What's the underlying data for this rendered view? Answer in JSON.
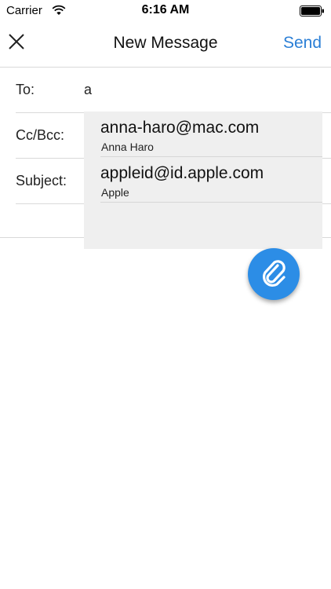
{
  "status_bar": {
    "carrier": "Carrier",
    "time": "6:16 AM",
    "wifi_icon": "wifi-icon",
    "battery_icon": "battery-full-icon"
  },
  "nav": {
    "title": "New Message",
    "close_icon": "close-icon",
    "send_label": "Send"
  },
  "fields": {
    "to_label": "To:",
    "to_value": "a",
    "cc_label": "Cc/Bcc:",
    "subject_label": "Subject:"
  },
  "suggestions": [
    {
      "email": "anna-haro@mac.com",
      "name": "Anna Haro"
    },
    {
      "email": "appleid@id.apple.com",
      "name": "Apple"
    }
  ],
  "fab": {
    "icon": "paperclip-icon"
  },
  "colors": {
    "accent": "#2b7fd6",
    "fab": "#2c8de6",
    "dropdown_bg": "#efefef",
    "divider": "#d9d9d9"
  }
}
